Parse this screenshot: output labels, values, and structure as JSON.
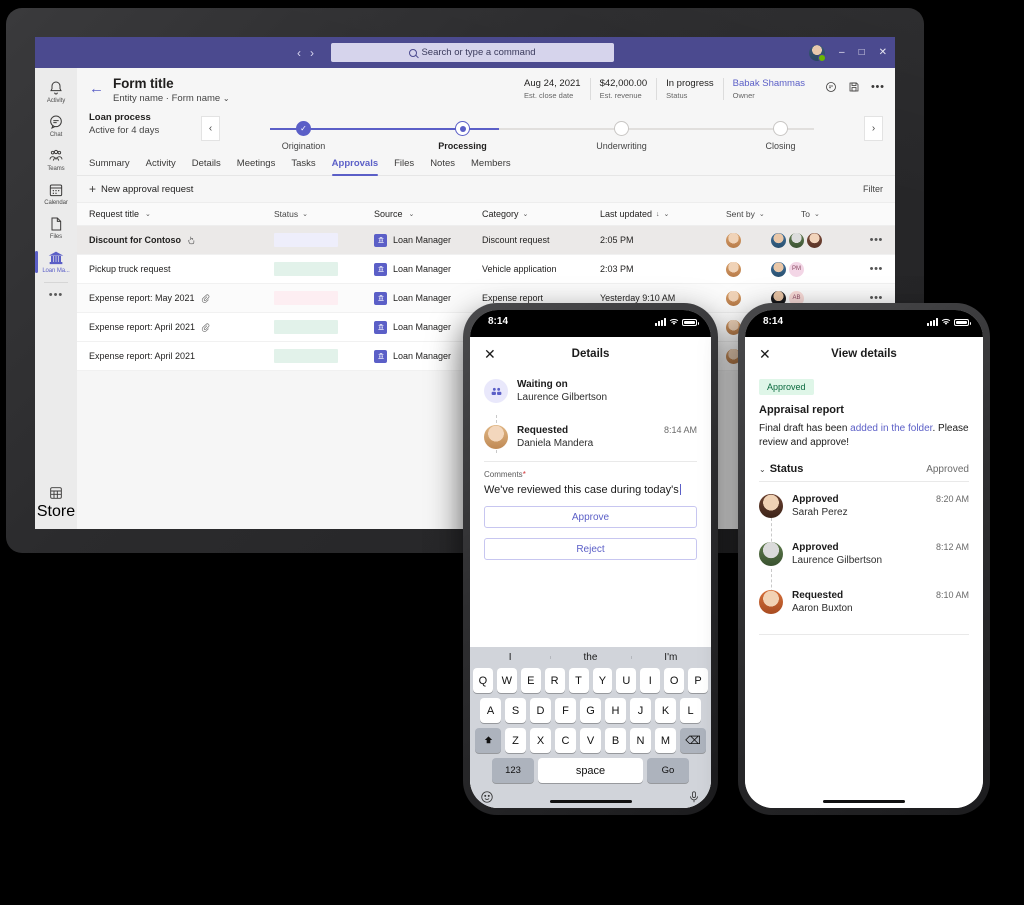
{
  "desktop": {
    "titlebar": {
      "back_icon": "chevron-left-icon",
      "forward_icon": "chevron-right-icon",
      "search_placeholder": "Search or type a command",
      "minimize_label": "–",
      "maximize_label": "□",
      "close_label": "✕"
    },
    "rail": [
      {
        "label": "Activity",
        "icon": "bell-icon"
      },
      {
        "label": "Chat",
        "icon": "chat-icon"
      },
      {
        "label": "Teams",
        "icon": "teams-icon"
      },
      {
        "label": "Calendar",
        "icon": "calendar-icon"
      },
      {
        "label": "Files",
        "icon": "file-icon"
      },
      {
        "label": "Loan Ma...",
        "icon": "bank-icon"
      }
    ],
    "rail_more": "•••",
    "rail_store": {
      "label": "Store",
      "icon": "store-icon"
    },
    "header": {
      "title": "Form title",
      "subtitle": "Entity name · Form name",
      "subtitle_chevron": "⌄",
      "meta": [
        {
          "value": "Aug 24, 2021",
          "key": "Est. close date"
        },
        {
          "value": "$42,000.00",
          "key": "Est. revenue"
        },
        {
          "value": "In progress",
          "key": "Status"
        },
        {
          "value": "Babak Shammas",
          "key": "Owner"
        }
      ],
      "icons": [
        "comment-icon",
        "save-icon",
        "more-icon"
      ]
    },
    "process": {
      "name": "Loan process",
      "sub": "Active for 4 days",
      "prev_label": "‹",
      "next_label": "›",
      "steps": [
        {
          "label": "Origination",
          "state": "done"
        },
        {
          "label": "Processing",
          "state": "current"
        },
        {
          "label": "Underwriting",
          "state": "todo"
        },
        {
          "label": "Closing",
          "state": "todo"
        }
      ]
    },
    "tabs": [
      {
        "label": "Summary",
        "active": false
      },
      {
        "label": "Activity",
        "active": false
      },
      {
        "label": "Details",
        "active": false
      },
      {
        "label": "Meetings",
        "active": false
      },
      {
        "label": "Tasks",
        "active": false
      },
      {
        "label": "Approvals",
        "active": true
      },
      {
        "label": "Files",
        "active": false
      },
      {
        "label": "Notes",
        "active": false
      },
      {
        "label": "Members",
        "active": false
      }
    ],
    "commandbar": {
      "new_request": "New approval request",
      "plus": "+",
      "filter": "Filter"
    },
    "table": {
      "columns": [
        "Request title",
        "Status",
        "Source",
        "Category",
        "Last updated",
        "Sent by",
        "To"
      ],
      "sort_arrow": "↓",
      "chevron": "⌄",
      "rows": [
        {
          "title": "Discount for Contoso",
          "attachment": false,
          "status_color": "#eeeefb",
          "source": "Loan Manager",
          "category": "Discount request",
          "updated": "2:05 PM",
          "to_count": 3,
          "more": "•••"
        },
        {
          "title": "Pickup truck request",
          "attachment": false,
          "status_color": "#e2f2ea",
          "source": "Loan Manager",
          "category": "Vehicle application",
          "updated": "2:03 PM",
          "to_count": 2,
          "to_initials": "PM",
          "more": "•••"
        },
        {
          "title": "Expense report: May 2021",
          "attachment": true,
          "status_color": "#fdeef2",
          "source": "Loan Manager",
          "category": "Expense report",
          "updated": "Yesterday 9:10 AM",
          "to_count": 2,
          "to_initials": "AB",
          "more": "•••"
        },
        {
          "title": "Expense report: April 2021",
          "attachment": true,
          "status_color": "#e2f2ea",
          "source": "Loan Manager",
          "category": "",
          "updated": "",
          "to_count": 0,
          "more": ""
        },
        {
          "title": "Expense report: April 2021",
          "attachment": false,
          "status_color": "#e2f2ea",
          "source": "Loan Manager",
          "category": "",
          "updated": "",
          "to_count": 0,
          "more": ""
        }
      ]
    }
  },
  "phone_left": {
    "status": {
      "time": "8:14",
      "signal": "signal-icon",
      "wifi": "wifi-icon",
      "battery": "battery-icon"
    },
    "close_label": "✕",
    "title": "Details",
    "items": [
      {
        "t1": "Waiting on",
        "t2": "Laurence Gilbertson",
        "time": "",
        "icon": "people-icon"
      },
      {
        "t1": "Requested",
        "t2": "Daniela Mandera",
        "time": "8:14 AM",
        "icon": "avatar"
      }
    ],
    "comments_label": "Comments",
    "required_mark": "*",
    "comments_value": "We've reviewed this case during today's",
    "approve_label": "Approve",
    "reject_label": "Reject",
    "keyboard": {
      "predictions": [
        "I",
        "the",
        "I'm"
      ],
      "row1": [
        "Q",
        "W",
        "E",
        "R",
        "T",
        "Y",
        "U",
        "I",
        "O",
        "P"
      ],
      "row2": [
        "A",
        "S",
        "D",
        "F",
        "G",
        "H",
        "J",
        "K",
        "L"
      ],
      "row3": [
        "Z",
        "X",
        "C",
        "V",
        "B",
        "N",
        "M"
      ],
      "shift": "⬆",
      "backspace": "⌫",
      "numbers": "123",
      "space": "space",
      "go": "Go",
      "emoji": "emoji-icon",
      "mic": "microphone-icon"
    }
  },
  "phone_right": {
    "status": {
      "time": "8:14",
      "signal": "signal-icon",
      "wifi": "wifi-icon",
      "battery": "battery-icon"
    },
    "close_label": "✕",
    "title": "View details",
    "badge": "Approved",
    "request_title": "Appraisal report",
    "body_before": "Final draft has been ",
    "body_link": "added in the folder",
    "body_after": ". Please review and approve!",
    "status_section": {
      "chevron": "⌄",
      "label": "Status",
      "value": "Approved"
    },
    "timeline": [
      {
        "t1": "Approved",
        "t2": "Sarah Perez",
        "time": "8:20 AM"
      },
      {
        "t1": "Approved",
        "t2": "Laurence Gilbertson",
        "time": "8:12 AM"
      },
      {
        "t1": "Requested",
        "t2": "Aaron Buxton",
        "time": "8:10 AM"
      }
    ]
  },
  "colors": {
    "brand_purple": "#5b5fc7",
    "titlebar_purple": "#4b4a8f",
    "approved_green_bg": "#dff6e8",
    "approved_green_text": "#0b6a3f"
  }
}
